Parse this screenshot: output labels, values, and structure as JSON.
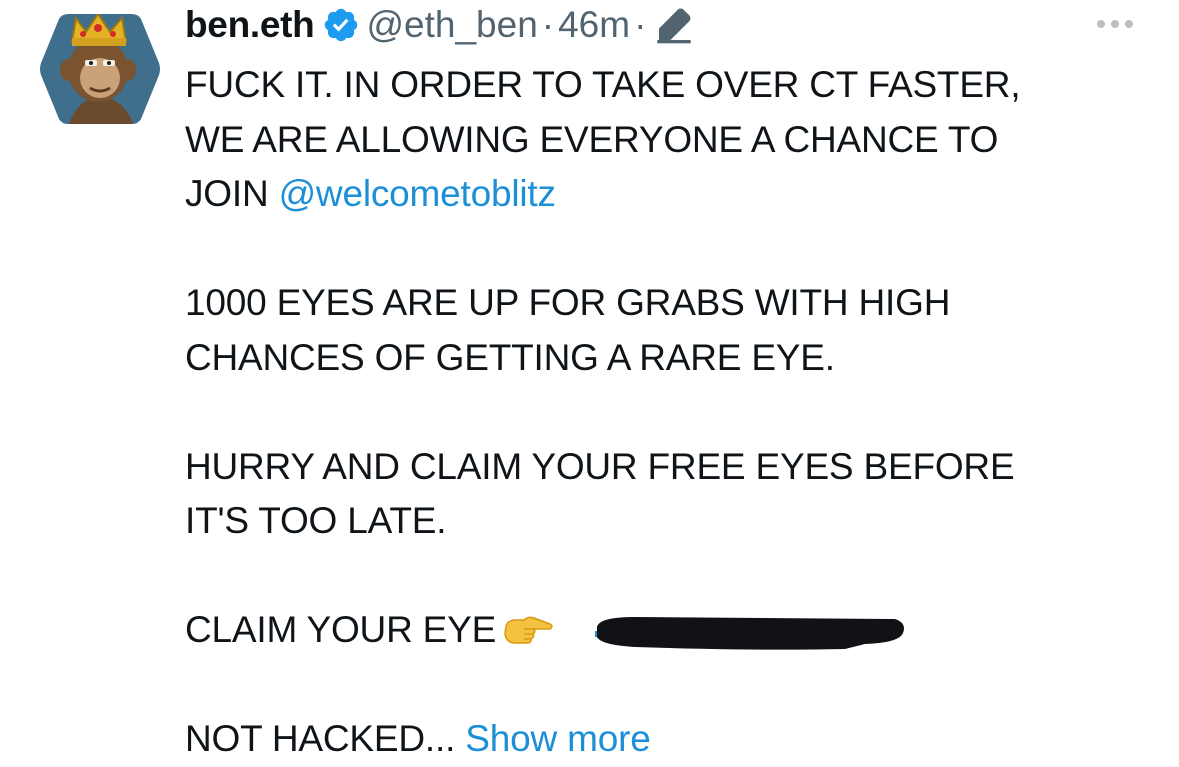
{
  "author": {
    "name": "ben.eth",
    "handle": "@eth_ben",
    "separator": "·",
    "time": "46m",
    "separator2": "·"
  },
  "icons": {
    "verified": "verified-badge-icon",
    "edited": "pencil-edit-icon",
    "more": "more-options-icon",
    "pointer": "backhand-index-pointing-right-emoji"
  },
  "tweet": {
    "line1": "FUCK IT. IN ORDER TO TAKE OVER CT FASTER,",
    "line2": "WE ARE ALLOWING EVERYONE A CHANCE TO",
    "line3_prefix": "JOIN ",
    "mention": "@welcometoblitz",
    "line4": "1000 EYES ARE UP FOR GRABS WITH HIGH",
    "line5": "CHANCES OF GETTING A RARE EYE.",
    "line6": "HURRY AND CLAIM YOUR FREE EYES BEFORE",
    "line7": "IT'S TOO LATE.",
    "line8": "CLAIM YOUR EYE",
    "line9": "NOT HACKED...",
    "show_more": "Show more"
  },
  "colors": {
    "text": "#0f1419",
    "secondary": "#536471",
    "link": "#1d8fd6",
    "verified": "#1d9bf0",
    "redaction": "#111216"
  }
}
